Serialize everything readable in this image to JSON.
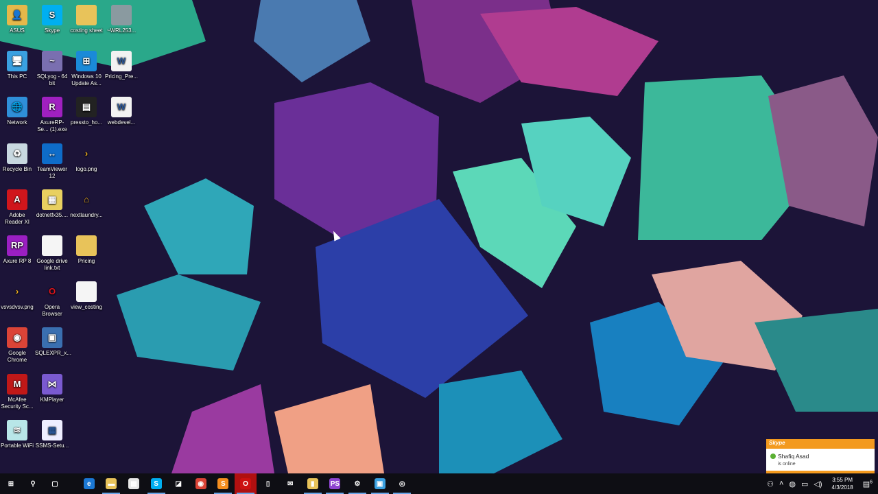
{
  "desktop_icons": [
    {
      "label": "ASUS",
      "col": 0,
      "row": 0,
      "color": "#e5b84a",
      "glyph": "👤"
    },
    {
      "label": "Skype",
      "col": 1,
      "row": 0,
      "color": "#00aff0",
      "glyph": "S"
    },
    {
      "label": "costing sheet",
      "col": 2,
      "row": 0,
      "color": "#e8c35a",
      "glyph": ""
    },
    {
      "label": "~WRL253...",
      "col": 3,
      "row": 0,
      "color": "#8a9aa0",
      "glyph": ""
    },
    {
      "label": "This PC",
      "col": 0,
      "row": 1,
      "color": "#3aa0e0",
      "glyph": "🖥"
    },
    {
      "label": "SQLyog - 64 bit",
      "col": 1,
      "row": 1,
      "color": "#7a6fb0",
      "glyph": "~"
    },
    {
      "label": "Windows 10 Update As...",
      "col": 2,
      "row": 1,
      "color": "#1a8ad8",
      "glyph": "⊞"
    },
    {
      "label": "Pricing_Pre...",
      "col": 3,
      "row": 1,
      "color": "#f2f2f2",
      "glyph": "W"
    },
    {
      "label": "Network",
      "col": 0,
      "row": 2,
      "color": "#2f8fd8",
      "glyph": "🌐"
    },
    {
      "label": "AxureRP-Se... (1).exe",
      "col": 1,
      "row": 2,
      "color": "#a020c0",
      "glyph": "R"
    },
    {
      "label": "pressto_ho...",
      "col": 2,
      "row": 2,
      "color": "#222",
      "glyph": "▤"
    },
    {
      "label": "webdevel...",
      "col": 3,
      "row": 2,
      "color": "#f2f2f2",
      "glyph": "W"
    },
    {
      "label": "Recycle Bin",
      "col": 0,
      "row": 3,
      "color": "#c8d8e0",
      "glyph": "♻"
    },
    {
      "label": "TeamViewer 12",
      "col": 1,
      "row": 3,
      "color": "#0e6cc9",
      "glyph": "↔"
    },
    {
      "label": "logo.png",
      "col": 2,
      "row": 3,
      "color": "transparent",
      "glyph": "›"
    },
    {
      "label": "Adobe Reader XI",
      "col": 0,
      "row": 4,
      "color": "#d0161c",
      "glyph": "A"
    },
    {
      "label": "dotnetfx35....",
      "col": 1,
      "row": 4,
      "color": "#e8d060",
      "glyph": "▦"
    },
    {
      "label": "nextlaundry...",
      "col": 2,
      "row": 4,
      "color": "transparent",
      "glyph": "⌂"
    },
    {
      "label": "Axure RP 8",
      "col": 0,
      "row": 5,
      "color": "#9b1fc2",
      "glyph": "RP"
    },
    {
      "label": "Google drive link.txt",
      "col": 1,
      "row": 5,
      "color": "#f5f5f5",
      "glyph": ""
    },
    {
      "label": "Pricing",
      "col": 2,
      "row": 5,
      "color": "#e8c35a",
      "glyph": ""
    },
    {
      "label": "vsvsdvsv.png",
      "col": 0,
      "row": 6,
      "color": "transparent",
      "glyph": "›"
    },
    {
      "label": "Opera Browser",
      "col": 1,
      "row": 6,
      "color": "transparent",
      "glyph": "O"
    },
    {
      "label": "view_costing",
      "col": 2,
      "row": 6,
      "color": "#f5f5f5",
      "glyph": ""
    },
    {
      "label": "Google Chrome",
      "col": 0,
      "row": 7,
      "color": "#db4437",
      "glyph": "◉"
    },
    {
      "label": "SQLEXPR_x...",
      "col": 1,
      "row": 7,
      "color": "#3a6fb0",
      "glyph": "▣"
    },
    {
      "label": "McAfee Security Sc...",
      "col": 0,
      "row": 8,
      "color": "#c01818",
      "glyph": "M"
    },
    {
      "label": "KMPlayer",
      "col": 1,
      "row": 8,
      "color": "#7a5ad0",
      "glyph": "⋈"
    },
    {
      "label": "Portable WiFi",
      "col": 0,
      "row": 9,
      "color": "#b8e6e8",
      "glyph": "≋"
    },
    {
      "label": "SSMS-Setu...",
      "col": 1,
      "row": 9,
      "color": "#eef",
      "glyph": "▦"
    }
  ],
  "taskbar": [
    {
      "name": "start",
      "glyph": "⊞",
      "color": "transparent",
      "open": false
    },
    {
      "name": "search",
      "glyph": "⚲",
      "color": "transparent",
      "open": false
    },
    {
      "name": "task-view",
      "glyph": "▢",
      "color": "transparent",
      "open": false
    },
    {
      "name": "edge",
      "glyph": "e",
      "color": "#1b78d4",
      "open": false
    },
    {
      "name": "file-explorer",
      "glyph": "▬",
      "color": "#e8c35a",
      "open": true
    },
    {
      "name": "store",
      "glyph": "▦",
      "color": "#e8e8e8",
      "open": false
    },
    {
      "name": "skype",
      "glyph": "S",
      "color": "#00aff0",
      "open": true
    },
    {
      "name": "sticky",
      "glyph": "◪",
      "color": "#fff",
      "open": false
    },
    {
      "name": "chrome",
      "glyph": "◉",
      "color": "#db4437",
      "open": false
    },
    {
      "name": "sublime",
      "glyph": "S",
      "color": "#f58e1f",
      "open": true
    },
    {
      "name": "opera",
      "glyph": "O",
      "color": "#cc1010",
      "open": true
    },
    {
      "name": "notepad",
      "glyph": "▯",
      "color": "#fff",
      "open": false
    },
    {
      "name": "mail",
      "glyph": "✉",
      "color": "#fff",
      "open": false
    },
    {
      "name": "tools",
      "glyph": "▮",
      "color": "#e8c35a",
      "open": true
    },
    {
      "name": "phpstorm",
      "glyph": "PS",
      "color": "#8e44d0",
      "open": true
    },
    {
      "name": "settings",
      "glyph": "⚙",
      "color": "transparent",
      "open": true
    },
    {
      "name": "remote-desktop",
      "glyph": "▣",
      "color": "#3aa0e0",
      "open": true
    },
    {
      "name": "obs",
      "glyph": "◎",
      "color": "transparent",
      "open": true
    }
  ],
  "tray": {
    "time": "3:55 PM",
    "date": "4/3/2018",
    "notifications": "6"
  },
  "toast": {
    "brand": "Skype",
    "name": "Shafiq Asad",
    "status": "is online"
  }
}
